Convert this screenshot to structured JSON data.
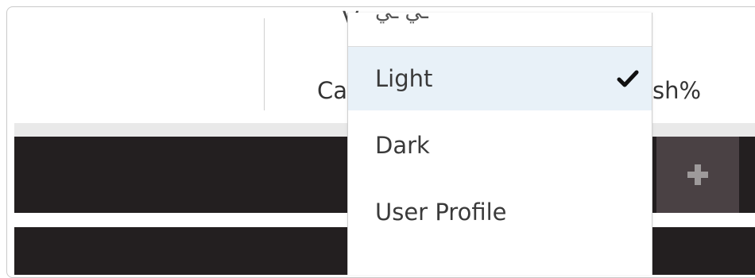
{
  "background": {
    "stat_label_left": "Ca",
    "stat_label_right": "sh%",
    "top_glyph": "V",
    "add_button_icon": "plus-icon"
  },
  "dropdown": {
    "partial_item_label": "ـي ـي",
    "items": [
      {
        "label": "Light",
        "selected": true,
        "icon": "checkmark-icon"
      },
      {
        "label": "Dark",
        "selected": false
      },
      {
        "label": "User Profile",
        "selected": false
      }
    ]
  },
  "colors": {
    "selected_item_bg": "#e8f1f8",
    "dark_bar": "#231f20",
    "add_button": "#4a4144"
  }
}
